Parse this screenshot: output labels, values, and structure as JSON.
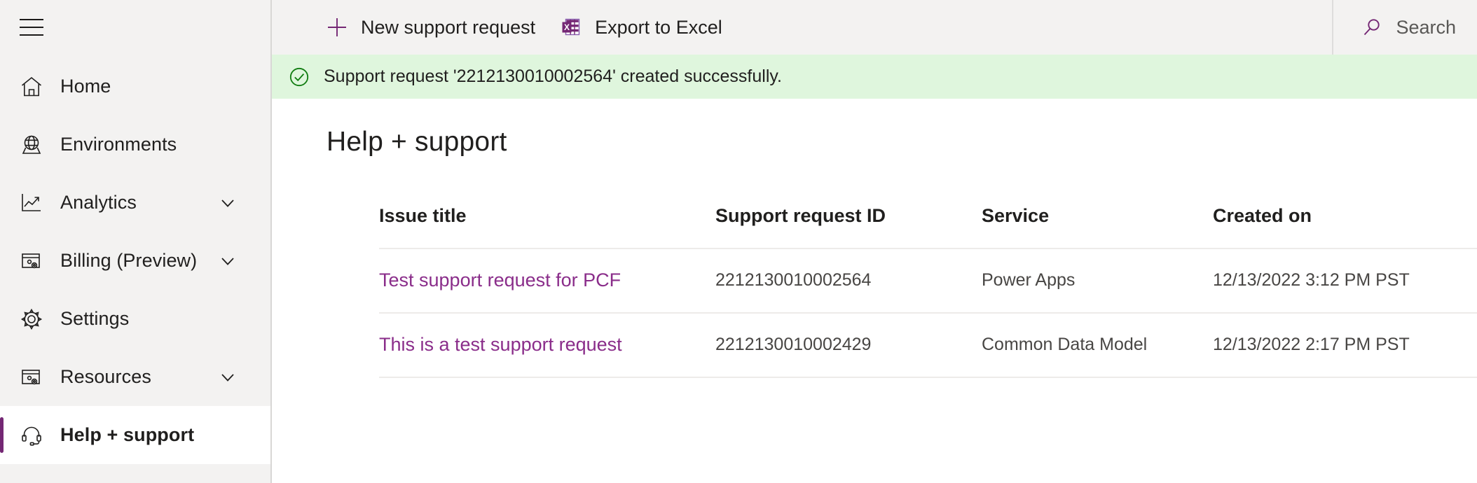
{
  "sidebar": {
    "menu_icon": "hamburger-icon",
    "items": [
      {
        "label": "Home",
        "icon": "home-icon",
        "chevron": false,
        "selected": false
      },
      {
        "label": "Environments",
        "icon": "globe-icon",
        "chevron": false,
        "selected": false
      },
      {
        "label": "Analytics",
        "icon": "chart-icon",
        "chevron": true,
        "selected": false
      },
      {
        "label": "Billing (Preview)",
        "icon": "billing-icon",
        "chevron": true,
        "selected": false
      },
      {
        "label": "Settings",
        "icon": "gear-icon",
        "chevron": false,
        "selected": false
      },
      {
        "label": "Resources",
        "icon": "resources-icon",
        "chevron": true,
        "selected": false
      },
      {
        "label": "Help + support",
        "icon": "headset-icon",
        "chevron": false,
        "selected": true
      }
    ]
  },
  "commandbar": {
    "new_request_label": "New support request",
    "new_request_icon": "plus-icon",
    "export_label": "Export to Excel",
    "export_icon": "excel-icon"
  },
  "search": {
    "placeholder": "Search",
    "icon": "search-icon"
  },
  "banner": {
    "icon": "check-circle-icon",
    "message": "Support request '2212130010002564' created successfully."
  },
  "page": {
    "title": "Help + support"
  },
  "table": {
    "columns": [
      "Issue title",
      "Support request ID",
      "Service",
      "Created on"
    ],
    "rows": [
      {
        "issue_title": "Test support request for PCF",
        "support_request_id": "2212130010002564",
        "service": "Power Apps",
        "created_on": "12/13/2022 3:12 PM PST"
      },
      {
        "issue_title": "This is a test support request",
        "support_request_id": "2212130010002429",
        "service": "Common Data Model",
        "created_on": "12/13/2022 2:17 PM PST"
      }
    ]
  },
  "colors": {
    "accent_purple": "#742774",
    "link_purple": "#8a2d8a",
    "sidebar_bg": "#f3f2f1",
    "banner_bg": "#dff6dd",
    "banner_icon": "#107c10",
    "text": "#201f1e"
  }
}
